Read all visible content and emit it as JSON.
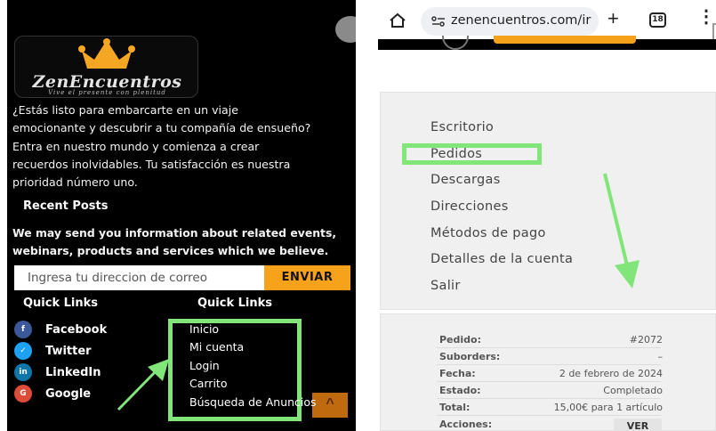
{
  "left_panel": {
    "logo": {
      "text": "ZenEncuentros",
      "tagline": "Vive el presente con plenitud"
    },
    "intro_lines": [
      "¿Estás listo para embarcarte en un viaje",
      "emocionante y descubrir a tu compañía de ensueño?",
      "Entra en nuestro mundo y comienza a crear",
      "recuerdos inolvidables. Tu satisfacción es nuestra",
      "prioridad número uno."
    ],
    "recent_posts_title": "Recent Posts",
    "info_lines": [
      "We may send you information about related events,",
      "webinars, products and services which we believe."
    ],
    "newsletter": {
      "placeholder": "Ingresa tu direccion de correo",
      "button_label": "ENVIAR"
    },
    "quick_links_titles": [
      "Quick Links",
      "Quick Links"
    ],
    "social_links": [
      {
        "label": "Facebook",
        "icon": "facebook-icon",
        "glyph": "f",
        "color": "#3b5998"
      },
      {
        "label": "Twitter",
        "icon": "twitter-icon",
        "glyph": "✓",
        "color": "#1da1f2"
      },
      {
        "label": "LinkedIn",
        "icon": "linkedin-icon",
        "glyph": "in",
        "color": "#0e76a8"
      },
      {
        "label": "Google",
        "icon": "google-icon",
        "glyph": "G",
        "color": "#dd4b39"
      }
    ],
    "quick_links": [
      "Inicio",
      "Mi cuenta",
      "Login",
      "Carrito",
      "Búsqueda de Anuncios"
    ],
    "scroll_top_icon": "^",
    "accent_color": "#f7a21b",
    "highlight_color": "#82e57a"
  },
  "right_panel": {
    "browser": {
      "url": "zenencuentros.com/ir",
      "tab_count": "18",
      "new_tab_icon": "+",
      "more_icon": "⋮"
    },
    "account_menu": [
      "Escritorio",
      "Pedidos",
      "Descargas",
      "Direcciones",
      "Métodos de pago",
      "Detalles de la cuenta",
      "Salir"
    ],
    "order": {
      "rows": [
        {
          "label": "Pedido:",
          "value": "#2072"
        },
        {
          "label": "Suborders:",
          "value": "–"
        },
        {
          "label": "Fecha:",
          "value": "2 de febrero de 2024"
        },
        {
          "label": "Estado:",
          "value": "Completado"
        },
        {
          "label": "Total:",
          "value": "15,00€ para 1 artículo"
        },
        {
          "label": "Acciones:",
          "value": ""
        }
      ],
      "action_button": "VER"
    }
  }
}
